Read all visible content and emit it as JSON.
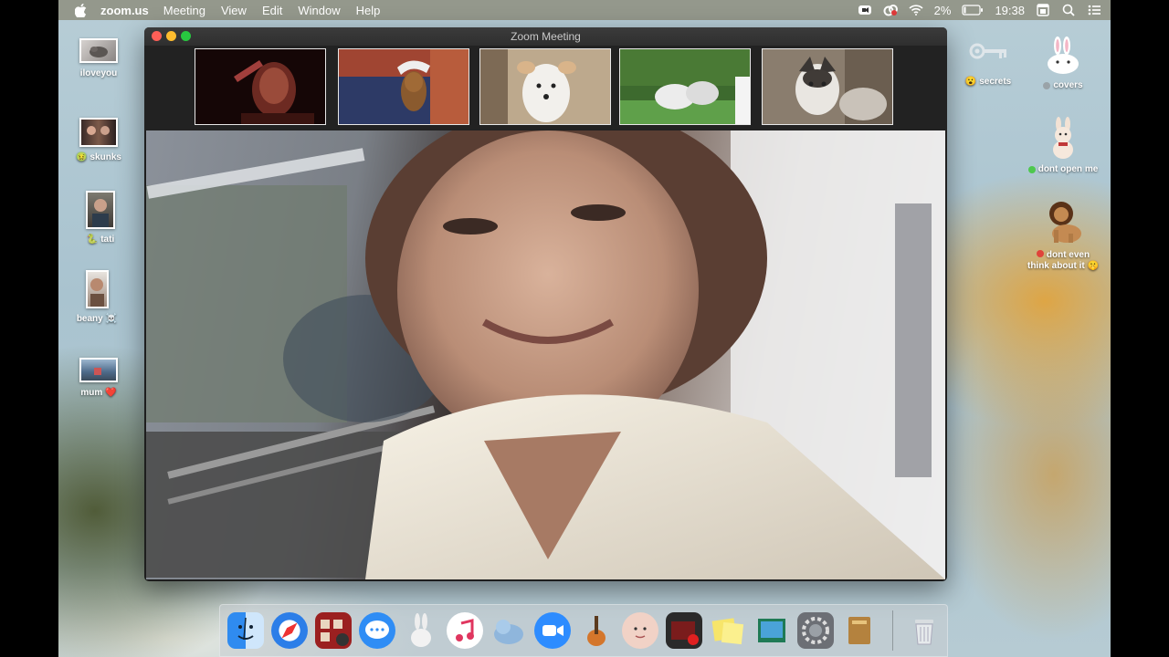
{
  "menubar": {
    "app_name": "zoom.us",
    "menus": [
      "Meeting",
      "View",
      "Edit",
      "Window",
      "Help"
    ],
    "battery_percent": "2%",
    "clock": "19:38"
  },
  "window": {
    "title": "Zoom Meeting"
  },
  "desktop_left": [
    {
      "label": "iloveyou"
    },
    {
      "label": "skunks",
      "prefix": "🤢"
    },
    {
      "label": "tati",
      "prefix": "🐍"
    },
    {
      "label": "beany",
      "suffix": "☠️"
    },
    {
      "label": "mum",
      "suffix": "❤️"
    }
  ],
  "desktop_right": [
    {
      "label": "secrets",
      "prefix": "😮"
    },
    {
      "label": "covers"
    },
    {
      "label": "dont open me"
    },
    {
      "label_line1": "dont even",
      "label_line2": "think about it",
      "suffix": "🤫"
    }
  ],
  "colors": {
    "close": "#fe5f57",
    "minimize": "#febc2e",
    "zoom": "#28c840",
    "dot_gray": "#9aa3a8",
    "dot_green": "#4ec84e",
    "dot_red": "#e0433a"
  },
  "dock": [
    "finder-icon",
    "safari-icon",
    "photo-booth-icon",
    "messages-icon",
    "app-icon",
    "music-icon",
    "app-icon",
    "zoom-icon",
    "garageband-icon",
    "face-icon",
    "app-icon",
    "stickies-icon",
    "preview-icon",
    "system-preferences-icon",
    "notes-icon",
    "trash-icon"
  ]
}
